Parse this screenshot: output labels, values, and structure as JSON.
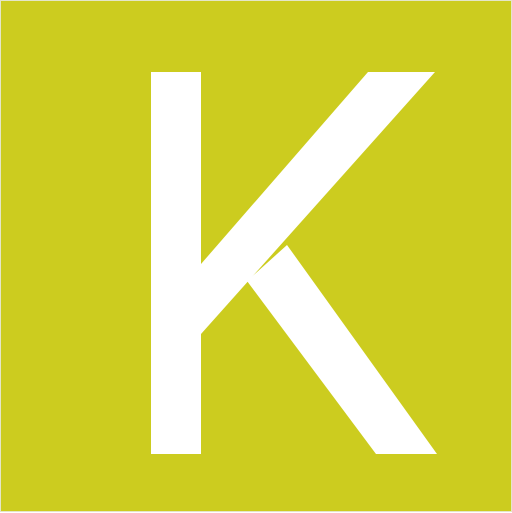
{
  "logo": {
    "letter": "K",
    "background_color": "#CCCC1F",
    "letter_color": "#FFFFFF"
  }
}
